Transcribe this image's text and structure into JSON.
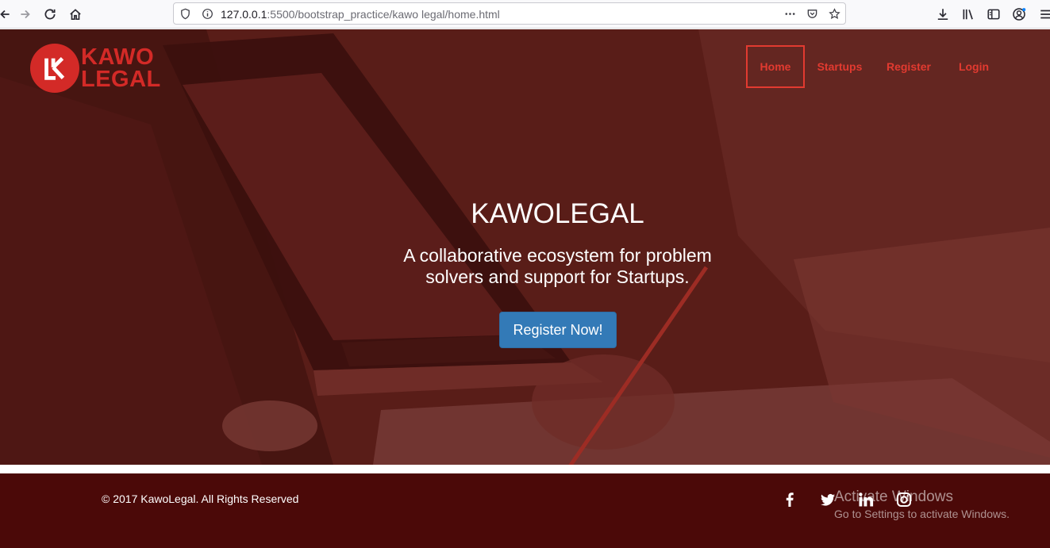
{
  "browser": {
    "url_host": "127.0.0.1",
    "url_path": ":5500/bootstrap_practice/kawo legal/home.html"
  },
  "brand": {
    "name_line1": "KAWO",
    "name_line2": "LEGAL",
    "color": "#d32a27"
  },
  "nav": {
    "items": [
      "Home",
      "Startups",
      "Register",
      "Login"
    ],
    "active": "Home",
    "color": "#e23a30"
  },
  "hero": {
    "title": "KAWOLEGAL",
    "subtitle": "A collaborative ecosystem for problem solvers and support for Startups.",
    "cta_label": "Register Now!",
    "cta_color": "#337ab7"
  },
  "footer": {
    "copyright": "© 2017 KawoLegal. All Rights Reserved",
    "background": "#4b0908",
    "social": [
      "facebook-icon",
      "twitter-icon",
      "linkedin-icon",
      "instagram-icon"
    ]
  },
  "watermark": {
    "title": "Activate Windows",
    "subtitle": "Go to Settings to activate Windows."
  }
}
